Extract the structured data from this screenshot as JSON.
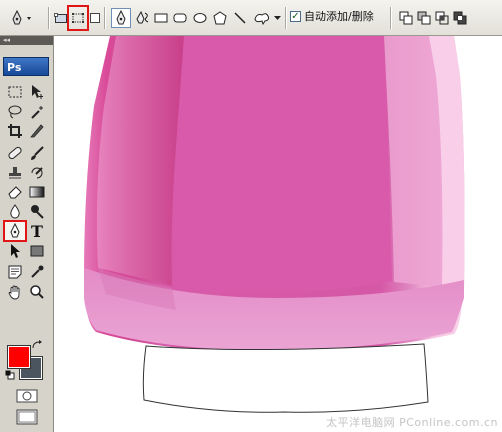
{
  "options_bar": {
    "auto_add_delete": {
      "label": "自动添加/删除",
      "checked": true
    }
  },
  "toolbox": {
    "logo": "Ps",
    "collapse_glyph": "◂◂",
    "foreground_color": "#ff0000",
    "background_color": "#4a5560",
    "type_tool_glyph": "T",
    "active_tool": "pen-icon"
  },
  "canvas": {
    "watermark": "太平洋电脑网 PConline.com.cn",
    "shape_color": "#d65aa8"
  },
  "highlight_color": "#e01515"
}
